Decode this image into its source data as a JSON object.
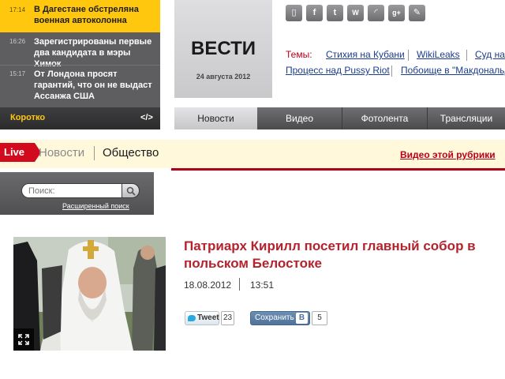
{
  "ticker": {
    "items": [
      {
        "time": "17:14",
        "headline": "В Дагестане обстреляна военная автоколонна"
      },
      {
        "time": "16:26",
        "headline": "Зарегистрированы первые два кандидата в мэры Химок"
      },
      {
        "time": "15:17",
        "headline": "От Лондона просят гарантий, что он не выдаст Ассанжа США"
      }
    ],
    "footer_label": "Коротко",
    "embed_code": "</>"
  },
  "logo": {
    "brand": "ВЕСТИ",
    "date": "24 августа 2012"
  },
  "social_icons": [
    "mobile-icon",
    "facebook-icon",
    "twitter-icon",
    "widget-icon",
    "rss-icon",
    "google-plus-icon",
    "livejournal-icon"
  ],
  "social_glyphs": [
    "▯",
    "f",
    "t",
    "W",
    "◜",
    "g+",
    "✎"
  ],
  "topics": {
    "label": "Темы:",
    "items": [
      "Стихия на Кубани",
      "WikiLeaks",
      "Суд на",
      "Процесс над Pussy Riot",
      "Побоище в \"Макдональд"
    ]
  },
  "nav": {
    "tabs": [
      "Новости",
      "Видео",
      "Фотолента",
      "Трансляции"
    ],
    "active": 0
  },
  "section": {
    "live": "Live",
    "crumb_parent": "Новости",
    "crumb_current": "Общество",
    "video_link": "Видео этой рубрики"
  },
  "search": {
    "placeholder": "Поиск:",
    "advanced": "Расширенный поиск"
  },
  "article": {
    "title": "Патриарх Кирилл посетил главный собор в польском Белостоке",
    "date": "18.08.2012",
    "time": "13:51"
  },
  "share": {
    "tweet_label": "Tweet",
    "tweet_count": "23",
    "vk_label": "Сохранить",
    "vk_logo": "В",
    "vk_count": "5"
  },
  "colors": {
    "accent_red": "#b4232d",
    "live_red": "#d10a1e",
    "ticker_yellow": "#ffc80f",
    "link_blue": "#1a3d8f"
  }
}
